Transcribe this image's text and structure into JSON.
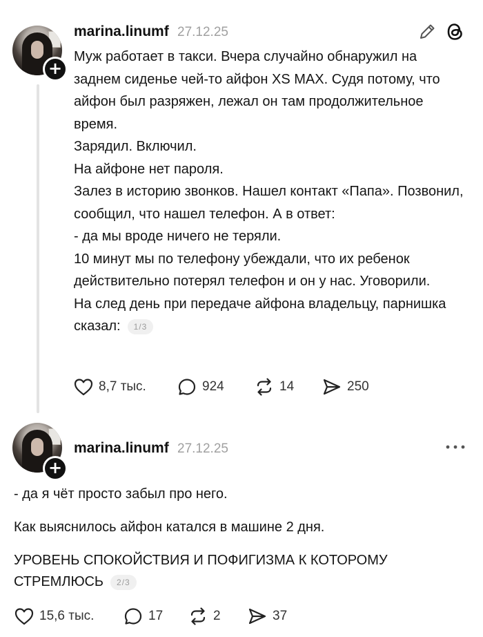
{
  "post1": {
    "username": "marina.linumf",
    "date": "27.12.25",
    "paragraphs": [
      "Муж работает в такси. Вчера случайно обнаружил на заднем сиденье чей-то айфон XS MAX. Судя потому, что айфон был разряжен, лежал он там продолжительное время.",
      "Зарядил. Включил.",
      "На айфоне нет пароля.",
      "Залез в историю звонков. Нашел контакт «Папа». Позвонил, сообщил, что нашел телефон. А в ответ:",
      "- да мы вроде ничего не теряли.",
      "10 минут мы по телефону убеждали, что их ребенок действительно потерял телефон и он у нас. Уговорили.",
      "На след день при передаче айфона владельцу, парнишка сказал:"
    ],
    "pager": "1/3",
    "likes": "8,7 тыс.",
    "comments": "924",
    "reposts": "14",
    "shares": "250"
  },
  "post2": {
    "username": "marina.linumf",
    "date": "27.12.25",
    "paragraphs": [
      "- да я чёт просто забыл про него.",
      "Как выяснилось айфон катался в машине 2 дня.",
      "УРОВЕНЬ СПОКОЙСТВИЯ И ПОФИГИЗМА К КОТОРОМУ СТРЕМЛЮСЬ"
    ],
    "pager": "2/3",
    "likes": "15,6 тыс.",
    "comments": "17",
    "reposts": "2",
    "shares": "37"
  },
  "icons": {
    "edit": "pencil-icon",
    "threads": "threads-logo-icon",
    "more": "more-dots-icon",
    "like": "heart-icon",
    "comment": "comment-bubble-icon",
    "repost": "repost-icon",
    "share": "send-icon"
  }
}
